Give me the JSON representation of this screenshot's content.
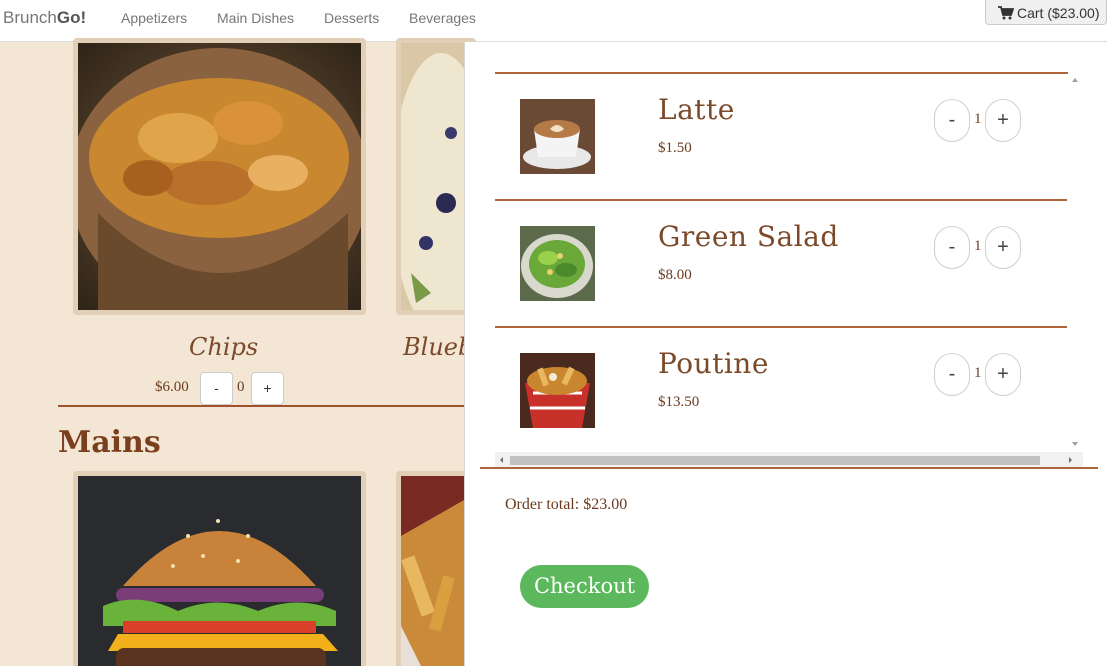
{
  "nav": {
    "brand_light": "Brunch",
    "brand_bold": "Go!",
    "links": [
      "Appetizers",
      "Main Dishes",
      "Desserts",
      "Beverages"
    ],
    "cart_label": "Cart ($23.00)",
    "cart_icon": "shopping-cart-icon"
  },
  "menu": {
    "appetizers": [
      {
        "name": "Chips",
        "price": "$6.00",
        "qty": "0",
        "minus": "-",
        "plus": "+"
      },
      {
        "name": "Blueb"
      }
    ],
    "mains_title": "Mains"
  },
  "cart": {
    "items": [
      {
        "name": "Latte",
        "price": "$1.50",
        "qty": "1",
        "minus": "-",
        "plus": "+"
      },
      {
        "name": "Green Salad",
        "price": "$8.00",
        "qty": "1",
        "minus": "-",
        "plus": "+"
      },
      {
        "name": "Poutine",
        "price": "$13.50",
        "qty": "1",
        "minus": "-",
        "plus": "+"
      }
    ],
    "total_label": "Order total: $23.00",
    "checkout_label": "Checkout"
  }
}
